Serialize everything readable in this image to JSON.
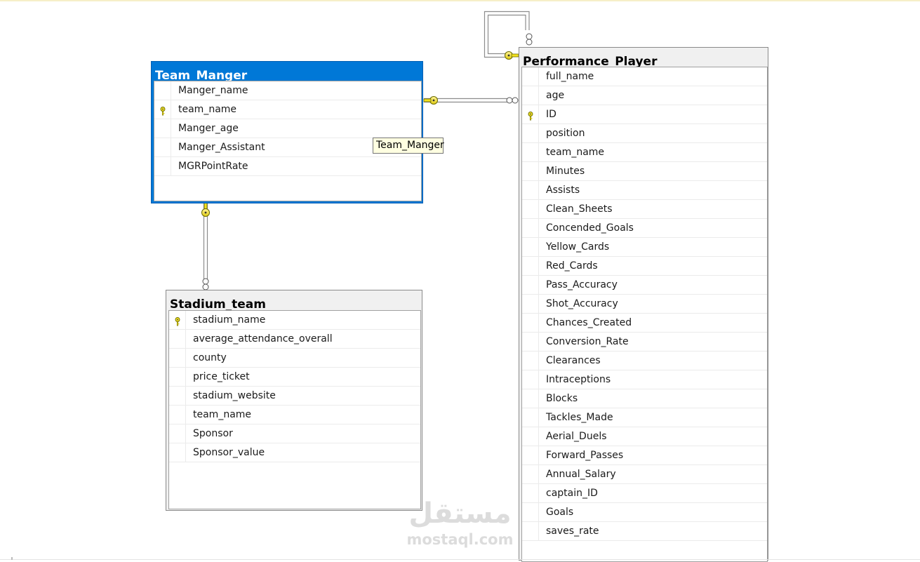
{
  "tables": {
    "team_manger": {
      "title": "Team_Manger",
      "columns": [
        {
          "name": "Manger_name",
          "key": false
        },
        {
          "name": "team_name",
          "key": true
        },
        {
          "name": "Manger_age",
          "key": false
        },
        {
          "name": "Manger_Assistant",
          "key": false
        },
        {
          "name": "MGRPointRate",
          "key": false
        }
      ]
    },
    "stadium_team": {
      "title": "Stadium_team",
      "columns": [
        {
          "name": "stadium_name",
          "key": true
        },
        {
          "name": "average_attendance_overall",
          "key": false
        },
        {
          "name": "county",
          "key": false
        },
        {
          "name": "price_ticket",
          "key": false
        },
        {
          "name": "stadium_website",
          "key": false
        },
        {
          "name": "team_name",
          "key": false
        },
        {
          "name": "Sponsor",
          "key": false
        },
        {
          "name": "Sponsor_value",
          "key": false
        }
      ]
    },
    "performance_player": {
      "title": "Performance_Player",
      "columns": [
        {
          "name": "full_name",
          "key": false
        },
        {
          "name": "age",
          "key": false
        },
        {
          "name": "ID",
          "key": true
        },
        {
          "name": "position",
          "key": false
        },
        {
          "name": "team_name",
          "key": false
        },
        {
          "name": "Minutes",
          "key": false
        },
        {
          "name": "Assists",
          "key": false
        },
        {
          "name": "Clean_Sheets",
          "key": false
        },
        {
          "name": "Concended_Goals",
          "key": false
        },
        {
          "name": "Yellow_Cards",
          "key": false
        },
        {
          "name": "Red_Cards",
          "key": false
        },
        {
          "name": "Pass_Accuracy",
          "key": false
        },
        {
          "name": "Shot_Accuracy",
          "key": false
        },
        {
          "name": "Chances_Created",
          "key": false
        },
        {
          "name": "Conversion_Rate",
          "key": false
        },
        {
          "name": "Clearances",
          "key": false
        },
        {
          "name": "Intraceptions",
          "key": false
        },
        {
          "name": "Blocks",
          "key": false
        },
        {
          "name": "Tackles_Made",
          "key": false
        },
        {
          "name": "Aerial_Duels",
          "key": false
        },
        {
          "name": "Forward_Passes",
          "key": false
        },
        {
          "name": "Annual_Salary",
          "key": false
        },
        {
          "name": "captain_ID",
          "key": false
        },
        {
          "name": "Goals",
          "key": false
        },
        {
          "name": "saves_rate",
          "key": false
        }
      ]
    }
  },
  "tooltip": {
    "text": "Team_Manger"
  },
  "watermark": {
    "logo": "مستقل",
    "url": "mostaql.com"
  },
  "colors": {
    "selected_header": "#0078d7",
    "key_icon": "#f2e21e",
    "relationship_line": "#8c8c8c",
    "tooltip_bg": "#ffffe1"
  }
}
